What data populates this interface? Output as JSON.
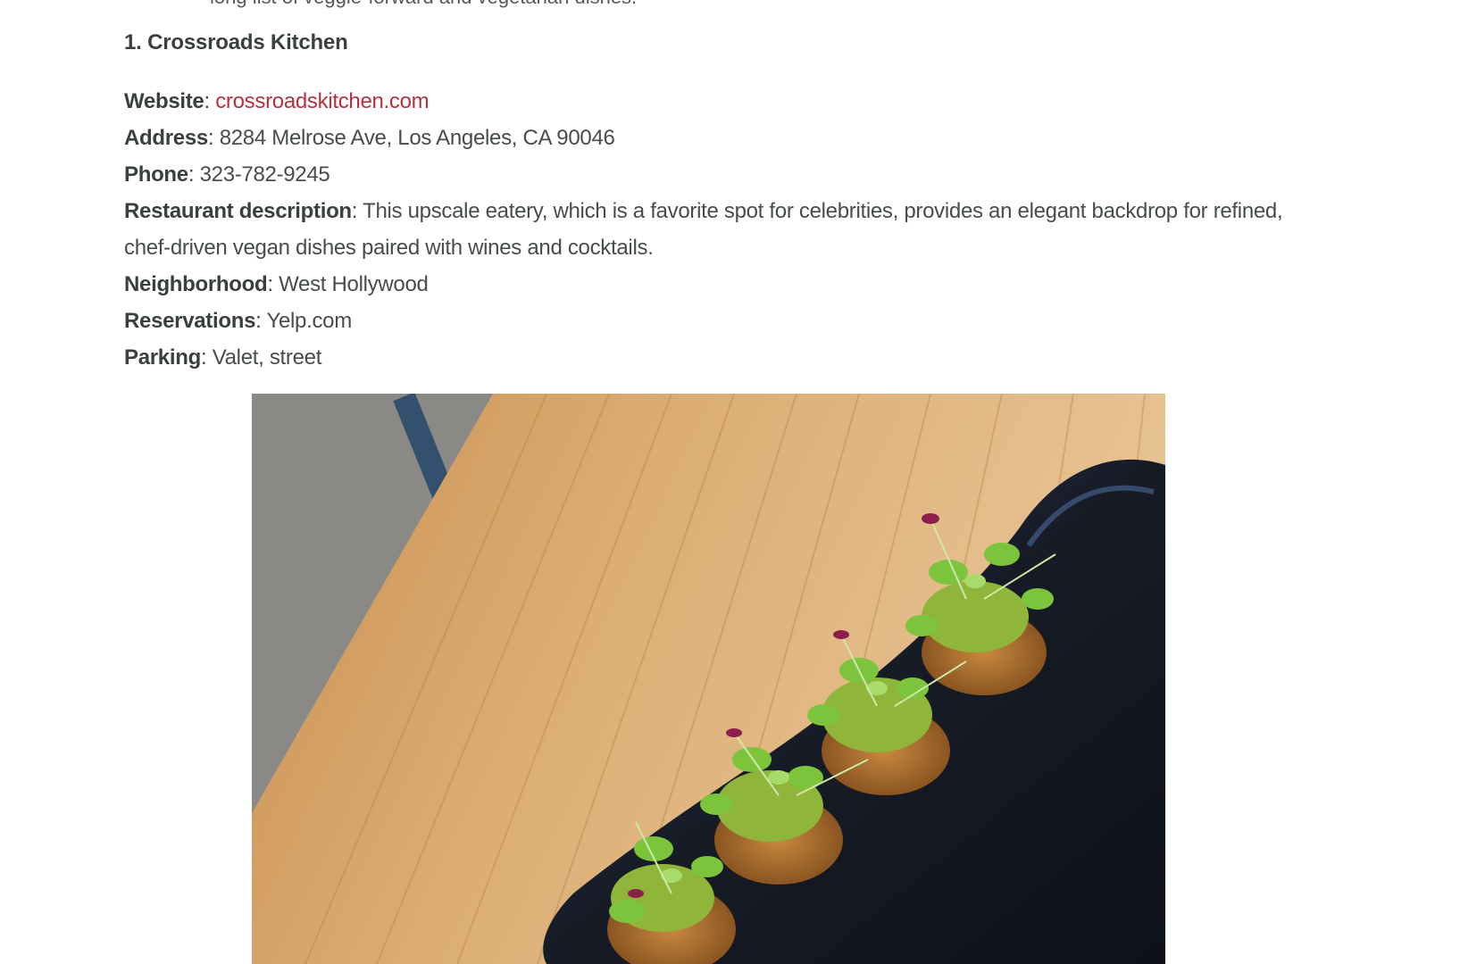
{
  "article": {
    "prev_line": "long list of veggie-forward and vegetarian dishes.",
    "heading": "1. Crossroads Kitchen",
    "website": {
      "label": "Website",
      "sep": ":",
      "value": "crossroadskitchen.com",
      "link_color": "#b5323c"
    },
    "address": {
      "label": "Address",
      "sep": ":",
      "value": "8284 Melrose Ave, Los Angeles, CA 90046"
    },
    "phone": {
      "label": "Phone",
      "sep": ":",
      "value": "323-782-9245"
    },
    "description": {
      "label": "Restaurant description",
      "sep": ":",
      "value": "This upscale eatery, which is a favorite spot for celebrities, provides an elegant backdrop for refined, chef-driven vegan dishes paired with wines and cocktails."
    },
    "neighborhood": {
      "label": "Neighborhood",
      "sep": ":",
      "value": "West Hollywood"
    },
    "reservations": {
      "label": "Reservations",
      "sep": ":",
      "value": "Yelp.com"
    },
    "parking": {
      "label": "Parking",
      "sep": ":",
      "value": "Valet, street"
    }
  },
  "photo": {
    "subject": "vegan appetizers with microgreens on black plate over wooden table",
    "colors": {
      "wood": "#d9a66a",
      "plate": "#1c2230",
      "greens": "#7cbf3a",
      "floor": "#8a8a86"
    }
  }
}
